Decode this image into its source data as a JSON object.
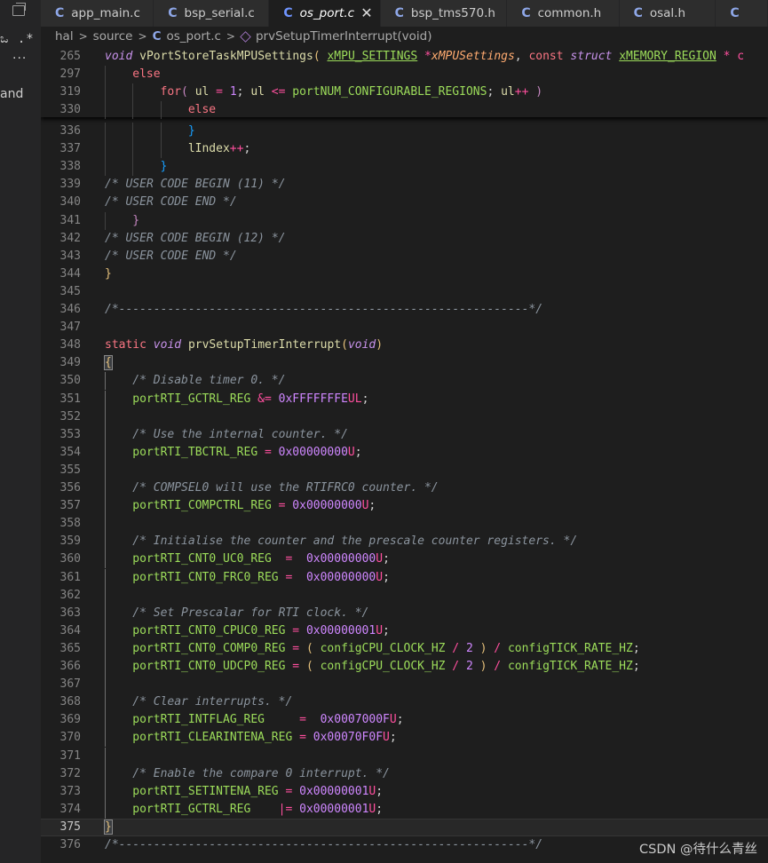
{
  "window": {
    "controls_icon": "restore-window-icon"
  },
  "activity_bar": {
    "partial_mark": "ಒ .*",
    "more": "···",
    "partial_label": "and"
  },
  "tabs": [
    {
      "label": "app_main.c",
      "icon": "C",
      "italic": false,
      "active": false,
      "w": 131
    },
    {
      "label": "bsp_serial.c",
      "icon": "C",
      "italic": false,
      "active": false,
      "w": 134
    },
    {
      "label": "os_port.c",
      "icon": "C",
      "italic": true,
      "active": true,
      "w": 129,
      "close": "✕"
    },
    {
      "label": "bsp_tms570.h",
      "icon": "C",
      "italic": false,
      "active": false,
      "w": 147
    },
    {
      "label": "common.h",
      "icon": "C",
      "italic": false,
      "active": false,
      "w": 130
    },
    {
      "label": "osal.h",
      "icon": "C",
      "italic": false,
      "active": false,
      "w": 112
    },
    {
      "label": "",
      "icon": "C",
      "italic": false,
      "active": false,
      "w": 60
    }
  ],
  "breadcrumb": [
    "hal",
    "source",
    "os_port.c",
    "prvSetupTimerInterrupt(void)"
  ],
  "colors": {
    "keyword": "#f97583",
    "storage": "#c792ea",
    "type": "#c792ea",
    "function": "#dcdcaa",
    "variable": "#dcdcaa",
    "macro": "#9cdc5a",
    "number": "#cf87ff",
    "comment": "#8b949e",
    "punct": "#d4d4d4",
    "operator": "#ff4f9e",
    "param": "#ffab70",
    "brace": "#e5c07b",
    "brace2": "#c586c0",
    "brace3": "#179fff"
  },
  "sticky_lines": [
    {
      "n": "265",
      "indent": 0,
      "tokens": [
        [
          "void ",
          "type"
        ],
        [
          "vPortStoreTaskMPUSettings",
          "function"
        ],
        [
          "( ",
          "brace"
        ],
        [
          "xMPU_SETTINGS",
          "macro",
          "u"
        ],
        [
          " *",
          "operator"
        ],
        [
          "xMPUSettings",
          "param"
        ],
        [
          ", ",
          "punct"
        ],
        [
          "const ",
          "keyword"
        ],
        [
          "struct ",
          "type"
        ],
        [
          "xMEMORY_REGION",
          "macro",
          "u"
        ],
        [
          " * c",
          "operator"
        ]
      ]
    },
    {
      "n": "297",
      "indent": 1,
      "tokens": [
        [
          "else",
          "keyword"
        ]
      ]
    },
    {
      "n": "319",
      "indent": 2,
      "tokens": [
        [
          "for",
          "keyword"
        ],
        [
          "( ",
          "brace2"
        ],
        [
          "ul",
          "variable"
        ],
        [
          " = ",
          "operator"
        ],
        [
          "1",
          "number"
        ],
        [
          "; ",
          "punct"
        ],
        [
          "ul",
          "variable"
        ],
        [
          " <= ",
          "operator"
        ],
        [
          "portNUM_CONFIGURABLE_REGIONS",
          "macro"
        ],
        [
          "; ",
          "punct"
        ],
        [
          "ul",
          "variable"
        ],
        [
          "++ ",
          "operator"
        ],
        [
          ")",
          "brace2"
        ]
      ]
    },
    {
      "n": "330",
      "indent": 3,
      "tokens": [
        [
          "else",
          "keyword"
        ]
      ]
    }
  ],
  "lines": [
    {
      "n": "336",
      "indent": 3,
      "tokens": [
        [
          "}",
          "brace3"
        ]
      ]
    },
    {
      "n": "337",
      "indent": 3,
      "tokens": [
        [
          "lIndex",
          "variable"
        ],
        [
          "++",
          "operator"
        ],
        [
          ";",
          "punct"
        ]
      ]
    },
    {
      "n": "338",
      "indent": 2,
      "tokens": [
        [
          "}",
          "brace3"
        ]
      ]
    },
    {
      "n": "339",
      "indent": 0,
      "tokens": [
        [
          "/* USER CODE BEGIN (11) */",
          "comment"
        ]
      ]
    },
    {
      "n": "340",
      "indent": 0,
      "tokens": [
        [
          "/* USER CODE END */",
          "comment"
        ]
      ]
    },
    {
      "n": "341",
      "indent": 1,
      "tokens": [
        [
          "}",
          "brace2"
        ]
      ]
    },
    {
      "n": "342",
      "indent": 0,
      "tokens": [
        [
          "/* USER CODE BEGIN (12) */",
          "comment"
        ]
      ]
    },
    {
      "n": "343",
      "indent": 0,
      "tokens": [
        [
          "/* USER CODE END */",
          "comment"
        ]
      ]
    },
    {
      "n": "344",
      "indent": 0,
      "tokens": [
        [
          "}",
          "brace"
        ]
      ]
    },
    {
      "n": "345",
      "indent": 0,
      "tokens": []
    },
    {
      "n": "346",
      "indent": 0,
      "tokens": [
        [
          "/*-----------------------------------------------------------*/",
          "comment"
        ]
      ]
    },
    {
      "n": "347",
      "indent": 0,
      "tokens": []
    },
    {
      "n": "348",
      "indent": 0,
      "tokens": [
        [
          "static ",
          "keyword"
        ],
        [
          "void ",
          "type"
        ],
        [
          "prvSetupTimerInterrupt",
          "function"
        ],
        [
          "(",
          "brace"
        ],
        [
          "void",
          "type"
        ],
        [
          ")",
          "brace"
        ]
      ]
    },
    {
      "n": "349",
      "indent": 0,
      "tokens": [
        [
          "{",
          "brace"
        ]
      ],
      "bracket_box": true
    },
    {
      "n": "350",
      "indent": 1,
      "tokens": [
        [
          "/* Disable timer 0. */",
          "comment"
        ]
      ]
    },
    {
      "n": "351",
      "indent": 1,
      "tokens": [
        [
          "portRTI_GCTRL_REG",
          "macro"
        ],
        [
          " &= ",
          "operator"
        ],
        [
          "0x",
          "number"
        ],
        [
          "FFFFFFFE",
          "number"
        ],
        [
          "UL",
          "operator"
        ],
        [
          ";",
          "punct"
        ]
      ]
    },
    {
      "n": "352",
      "indent": 1,
      "tokens": []
    },
    {
      "n": "353",
      "indent": 1,
      "tokens": [
        [
          "/* Use the internal counter. */",
          "comment"
        ]
      ]
    },
    {
      "n": "354",
      "indent": 1,
      "tokens": [
        [
          "portRTI_TBCTRL_REG",
          "macro"
        ],
        [
          " = ",
          "operator"
        ],
        [
          "0x00000000",
          "number"
        ],
        [
          "U",
          "operator"
        ],
        [
          ";",
          "punct"
        ]
      ]
    },
    {
      "n": "355",
      "indent": 1,
      "tokens": []
    },
    {
      "n": "356",
      "indent": 1,
      "tokens": [
        [
          "/* COMPSEL0 will use the RTIFRC0 counter. */",
          "comment"
        ]
      ]
    },
    {
      "n": "357",
      "indent": 1,
      "tokens": [
        [
          "portRTI_COMPCTRL_REG",
          "macro"
        ],
        [
          " = ",
          "operator"
        ],
        [
          "0x00000000",
          "number"
        ],
        [
          "U",
          "operator"
        ],
        [
          ";",
          "punct"
        ]
      ]
    },
    {
      "n": "358",
      "indent": 1,
      "tokens": []
    },
    {
      "n": "359",
      "indent": 1,
      "tokens": [
        [
          "/* Initialise the counter and the prescale counter registers. */",
          "comment"
        ]
      ]
    },
    {
      "n": "360",
      "indent": 1,
      "tokens": [
        [
          "portRTI_CNT0_UC0_REG",
          "macro"
        ],
        [
          "  =  ",
          "operator"
        ],
        [
          "0x00000000",
          "number"
        ],
        [
          "U",
          "operator"
        ],
        [
          ";",
          "punct"
        ]
      ]
    },
    {
      "n": "361",
      "indent": 1,
      "tokens": [
        [
          "portRTI_CNT0_FRC0_REG",
          "macro"
        ],
        [
          " =  ",
          "operator"
        ],
        [
          "0x00000000",
          "number"
        ],
        [
          "U",
          "operator"
        ],
        [
          ";",
          "punct"
        ]
      ]
    },
    {
      "n": "362",
      "indent": 1,
      "tokens": []
    },
    {
      "n": "363",
      "indent": 1,
      "tokens": [
        [
          "/* Set Prescalar for RTI clock. */",
          "comment"
        ]
      ]
    },
    {
      "n": "364",
      "indent": 1,
      "tokens": [
        [
          "portRTI_CNT0_CPUC0_REG",
          "macro"
        ],
        [
          " = ",
          "operator"
        ],
        [
          "0x00000001",
          "number"
        ],
        [
          "U",
          "operator"
        ],
        [
          ";",
          "punct"
        ]
      ]
    },
    {
      "n": "365",
      "indent": 1,
      "tokens": [
        [
          "portRTI_CNT0_COMP0_REG",
          "macro"
        ],
        [
          " = ",
          "operator"
        ],
        [
          "( ",
          "brace"
        ],
        [
          "configCPU_CLOCK_HZ",
          "macro"
        ],
        [
          " / ",
          "operator"
        ],
        [
          "2",
          "number"
        ],
        [
          " ) ",
          "brace"
        ],
        [
          "/ ",
          "operator"
        ],
        [
          "configTICK_RATE_HZ",
          "macro"
        ],
        [
          ";",
          "punct"
        ]
      ]
    },
    {
      "n": "366",
      "indent": 1,
      "tokens": [
        [
          "portRTI_CNT0_UDCP0_REG",
          "macro"
        ],
        [
          " = ",
          "operator"
        ],
        [
          "( ",
          "brace"
        ],
        [
          "configCPU_CLOCK_HZ",
          "macro"
        ],
        [
          " / ",
          "operator"
        ],
        [
          "2",
          "number"
        ],
        [
          " ) ",
          "brace"
        ],
        [
          "/ ",
          "operator"
        ],
        [
          "configTICK_RATE_HZ",
          "macro"
        ],
        [
          ";",
          "punct"
        ]
      ]
    },
    {
      "n": "367",
      "indent": 1,
      "tokens": []
    },
    {
      "n": "368",
      "indent": 1,
      "tokens": [
        [
          "/* Clear interrupts. */",
          "comment"
        ]
      ]
    },
    {
      "n": "369",
      "indent": 1,
      "tokens": [
        [
          "portRTI_INTFLAG_REG",
          "macro"
        ],
        [
          "     =  ",
          "operator"
        ],
        [
          "0x0007000F",
          "number"
        ],
        [
          "U",
          "operator"
        ],
        [
          ";",
          "punct"
        ]
      ]
    },
    {
      "n": "370",
      "indent": 1,
      "tokens": [
        [
          "portRTI_CLEARINTENA_REG",
          "macro"
        ],
        [
          " = ",
          "operator"
        ],
        [
          "0x00070F0F",
          "number"
        ],
        [
          "U",
          "operator"
        ],
        [
          ";",
          "punct"
        ]
      ]
    },
    {
      "n": "371",
      "indent": 1,
      "tokens": []
    },
    {
      "n": "372",
      "indent": 1,
      "tokens": [
        [
          "/* Enable the compare 0 interrupt. */",
          "comment"
        ]
      ]
    },
    {
      "n": "373",
      "indent": 1,
      "tokens": [
        [
          "portRTI_SETINTENA_REG",
          "macro"
        ],
        [
          " = ",
          "operator"
        ],
        [
          "0x00000001",
          "number"
        ],
        [
          "U",
          "operator"
        ],
        [
          ";",
          "punct"
        ]
      ]
    },
    {
      "n": "374",
      "indent": 1,
      "tokens": [
        [
          "portRTI_GCTRL_REG",
          "macro"
        ],
        [
          "    |= ",
          "operator"
        ],
        [
          "0x00000001",
          "number"
        ],
        [
          "U",
          "operator"
        ],
        [
          ";",
          "punct"
        ]
      ]
    },
    {
      "n": "375",
      "indent": 0,
      "tokens": [
        [
          "}",
          "brace"
        ]
      ],
      "current": true,
      "bracket_box": true
    },
    {
      "n": "376",
      "indent": 0,
      "tokens": [
        [
          "/*-----------------------------------------------------------*/",
          "comment"
        ]
      ]
    }
  ],
  "watermark": "CSDN @待什么青丝"
}
